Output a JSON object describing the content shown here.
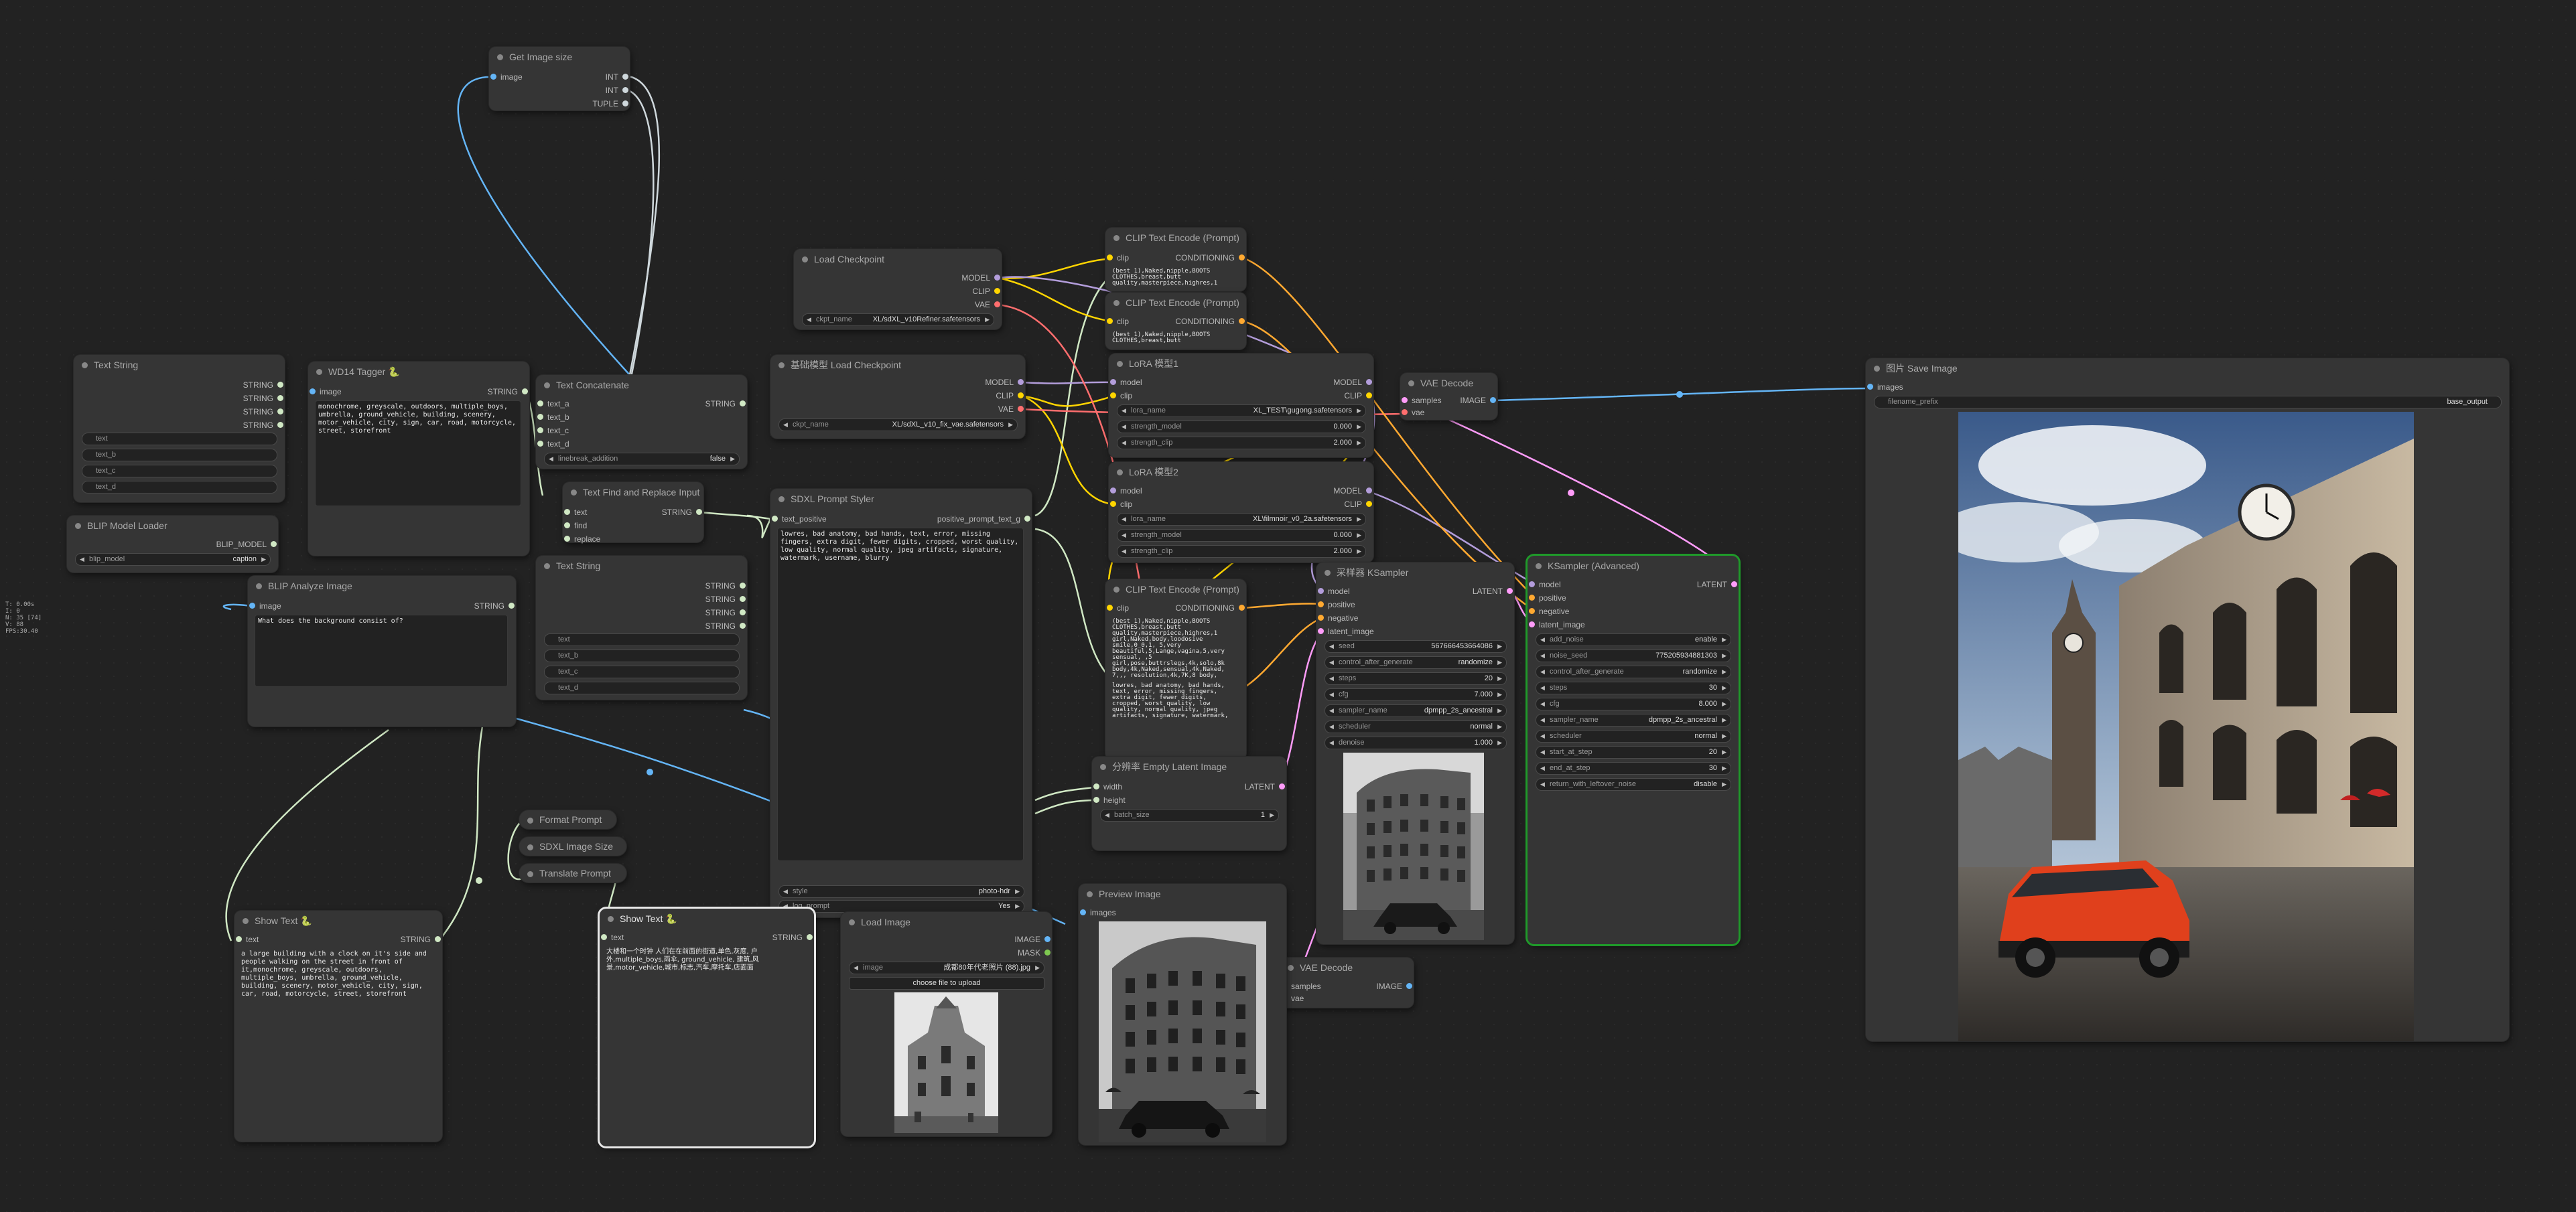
{
  "colors": {
    "canvas": "#222222",
    "node": "#353535",
    "image": "#64b5f6",
    "clip": "#ffd500",
    "model": "#b39ddb",
    "vae": "#ff6e6e",
    "conditioning": "#ffa931",
    "latent": "#ff9cf9",
    "string": "#d0e8c4",
    "int": "#cfd8dc"
  },
  "overlay": {
    "line1": "T: 0.00s",
    "line2": "I: 0",
    "line3": "N: 35 [74]",
    "line4": "V: 88",
    "line5": "FPS:30.40"
  },
  "nodes": {
    "get_image_size": {
      "title": "Get Image size",
      "in_image": "image",
      "out1": "INT",
      "out2": "INT",
      "out3": "TUPLE"
    },
    "text_string_1": {
      "title": "Text String",
      "out": "STRING",
      "w1": "text",
      "w2": "text_b",
      "w3": "text_c",
      "w4": "text_d"
    },
    "wd14": {
      "title": "WD14 Tagger 🐍",
      "in_image": "image",
      "out": "STRING",
      "text": "monochrome, greyscale, outdoors, multiple_boys, umbrella, ground_vehicle, building, scenery, motor_vehicle, city, sign, car, road, motorcycle, street, storefront"
    },
    "text_concat": {
      "title": "Text Concatenate",
      "in1": "text_a",
      "in2": "text_b",
      "in3": "text_c",
      "in4": "text_d",
      "out": "STRING",
      "w_label": "linebreak_addition",
      "w_val": "false"
    },
    "text_find_replace": {
      "title": "Text Find and Replace Input",
      "in1": "text",
      "in2": "find",
      "in3": "replace",
      "out": "STRING"
    },
    "text_string_2": {
      "title": "Text String",
      "out": "STRING",
      "w1": "text",
      "w2": "text_b",
      "w3": "text_c",
      "w4": "text_d"
    },
    "blip_loader": {
      "title": "BLIP Model Loader",
      "out": "BLIP_MODEL",
      "w_label": "blip_model",
      "w_val": "caption"
    },
    "blip_analyze": {
      "title": "BLIP Analyze Image",
      "in_image": "image",
      "out": "STRING",
      "text": "What does the background consist of?"
    },
    "load_checkpoint": {
      "title": "Load Checkpoint",
      "o1": "MODEL",
      "o2": "CLIP",
      "o3": "VAE",
      "w_label": "ckpt_name",
      "w_val": "XL/sdXL_v10Refiner.safetensors"
    },
    "base_checkpoint": {
      "title": "基础模型 Load Checkpoint",
      "o1": "MODEL",
      "o2": "CLIP",
      "o3": "VAE",
      "w_label": "ckpt_name",
      "w_val": "XL/sdXL_v10_fix_vae.safetensors"
    },
    "sdxl_styler": {
      "title": "SDXL Prompt Styler",
      "in1": "text_positive",
      "out": "positive_prompt_text_g",
      "text": "lowres, bad anatomy, bad hands, text, error, missing fingers, extra digit, fewer digits, cropped, worst quality, low quality, normal quality, jpeg artifacts, signature, watermark, username, blurry",
      "w1_label": "style",
      "w1_val": "photo-hdr",
      "w2_label": "log_prompt",
      "w2_val": "Yes"
    },
    "clip_enc_1": {
      "title": "CLIP Text Encode (Prompt)",
      "in": "clip",
      "out": "CONDITIONING",
      "text": "(best 1),Naked,nipple,BOOTS CLOTHES,breast,butt quality,masterpiece,highres,1"
    },
    "clip_enc_2": {
      "title": "CLIP Text Encode (Prompt)",
      "in": "clip",
      "out": "CONDITIONING",
      "text": "(best 1),Naked,nipple,BOOTS CLOTHES,breast,butt"
    },
    "lora_1": {
      "title": "LoRA 模型1",
      "i1": "model",
      "i2": "clip",
      "o1": "MODEL",
      "o2": "CLIP",
      "w1_label": "lora_name",
      "w1_val": "XL_TEST\\gugong.safetensors",
      "w2_label": "strength_model",
      "w2_val": "0.000",
      "w3_label": "strength_clip",
      "w3_val": "2.000"
    },
    "lora_2": {
      "title": "LoRA 模型2",
      "i1": "model",
      "i2": "clip",
      "o1": "MODEL",
      "o2": "CLIP",
      "w1_label": "lora_name",
      "w1_val": "XL\\filmnoir_v0_2a.safetensors",
      "w2_label": "strength_model",
      "w2_val": "0.000",
      "w3_label": "strength_clip",
      "w3_val": "2.000"
    },
    "clip_enc_3": {
      "title": "CLIP Text Encode (Prompt)",
      "in": "clip",
      "out": "CONDITIONING",
      "text": "(best 1),Naked,nipple,BOOTS CLOTHES,breast,butt quality,masterpiece,highres,1 girl,Naked,body,loodosive smile,0_0,1, 5,very beautiful,5,Lange,vagina,5,very sensual, ,5 girl,pose,buttrslegs,4k,solo,8k body,4k,Naked,sensual,4k,Naked, 7,,, resolution,4k,7K,8 body,",
      "text2": "lowres, bad anatomy, bad hands, text, error, missing fingers, extra digit, fewer digits, cropped, worst quality, low quality, normal quality, jpeg artifacts, signature, watermark,"
    },
    "empty_latent": {
      "title": "分辨率 Empty Latent Image",
      "i1": "width",
      "i2": "height",
      "out": "LATENT",
      "w_label": "batch_size",
      "w_val": "1"
    },
    "ksampler": {
      "title": "采样器 KSampler",
      "i1": "model",
      "i2": "positive",
      "i3": "negative",
      "i4": "latent_image",
      "out": "LATENT",
      "widgets": [
        {
          "label": "seed",
          "val": "567666453664086"
        },
        {
          "label": "control_after_generate",
          "val": "randomize"
        },
        {
          "label": "steps",
          "val": "20"
        },
        {
          "label": "cfg",
          "val": "7.000"
        },
        {
          "label": "sampler_name",
          "val": "dpmpp_2s_ancestral"
        },
        {
          "label": "scheduler",
          "val": "normal"
        },
        {
          "label": "denoise",
          "val": "1.000"
        }
      ]
    },
    "ksampler_adv": {
      "title": "KSampler (Advanced)",
      "i1": "model",
      "i2": "positive",
      "i3": "negative",
      "i4": "latent_image",
      "out": "LATENT",
      "widgets": [
        {
          "label": "add_noise",
          "val": "enable"
        },
        {
          "label": "noise_seed",
          "val": "775205934881303"
        },
        {
          "label": "control_after_generate",
          "val": "randomize"
        },
        {
          "label": "steps",
          "val": "30"
        },
        {
          "label": "cfg",
          "val": "8.000"
        },
        {
          "label": "sampler_name",
          "val": "dpmpp_2s_ancestral"
        },
        {
          "label": "scheduler",
          "val": "normal"
        },
        {
          "label": "start_at_step",
          "val": "20"
        },
        {
          "label": "end_at_step",
          "val": "30"
        },
        {
          "label": "return_with_leftover_noise",
          "val": "disable"
        }
      ]
    },
    "vae_decode_1": {
      "title": "VAE Decode",
      "i1": "samples",
      "i2": "vae",
      "out": "IMAGE"
    },
    "vae_decode_2": {
      "title": "VAE Decode",
      "i1": "samples",
      "i2": "vae",
      "out": "IMAGE"
    },
    "save_image": {
      "title": "图片 Save Image",
      "in": "images",
      "w_label": "filename_prefix",
      "w_val": "base_output"
    },
    "preview_image": {
      "title": "Preview Image",
      "in": "images"
    },
    "load_image": {
      "title": "Load Image",
      "o1": "IMAGE",
      "o2": "MASK",
      "w_label": "image",
      "w_val": "成都80年代老照片 (88).jpg",
      "btn": "choose file to upload"
    },
    "format_prompt": {
      "title": "Format Prompt"
    },
    "sdxl_image_size": {
      "title": "SDXL Image Size"
    },
    "translate_prompt": {
      "title": "Translate Prompt"
    },
    "show_text_1": {
      "title": "Show Text 🐍",
      "in": "text",
      "out": "STRING",
      "text": "a large building with a clock on it's side and people walking on the street in front of it,monochrome, greyscale, outdoors, multiple_boys, umbrella, ground_vehicle, building, scenery, motor_vehicle, city, sign, car, road, motorcycle, street, storefront"
    },
    "show_text_2": {
      "title": "Show Text 🐍",
      "in": "text",
      "out": "STRING",
      "text": "大楼和一个时钟 人们在在前面的街道,单色,灰度, 户外,multiple_boys,雨伞, ground_vehicle, 建筑,风景,motor_vehicle,城市,标志,汽车,摩托车,店面面"
    }
  }
}
